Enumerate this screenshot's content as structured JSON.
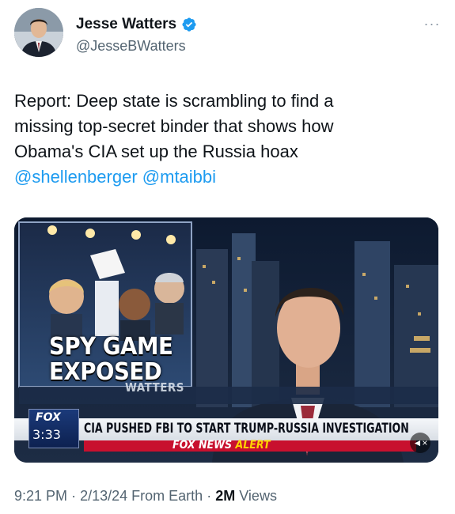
{
  "author": {
    "display_name": "Jesse Watters",
    "handle": "@JesseBWatters",
    "verified": true,
    "verified_color": "#1d9bf0"
  },
  "tweet": {
    "lines": [
      "Report: Deep state is scrambling to find a",
      "missing top-secret binder that shows how",
      "Obama's CIA set up the Russia hoax"
    ],
    "mentions": [
      "@shellenberger",
      "@mtaibbi"
    ]
  },
  "media": {
    "graphic_title_line1": "SPY GAME",
    "graphic_title_line2": "EXPOSED",
    "set_text": "WATTERS",
    "network_logo": "FOX",
    "timestamp": "3:33",
    "headline": "CIA PUSHED FBI TO START TRUMP-RUSSIA INVESTIGATION",
    "alert_network": "FOX NEWS",
    "alert_label": "ALERT",
    "mute_icon": "speaker-muted-icon"
  },
  "meta": {
    "time": "9:21 PM",
    "separator": "·",
    "date": "2/13/24",
    "source": "From Earth",
    "views_count": "2M",
    "views_label": "Views"
  },
  "colors": {
    "link": "#1d9bf0",
    "secondary_text": "#536471",
    "fox_red": "#c8102e"
  }
}
